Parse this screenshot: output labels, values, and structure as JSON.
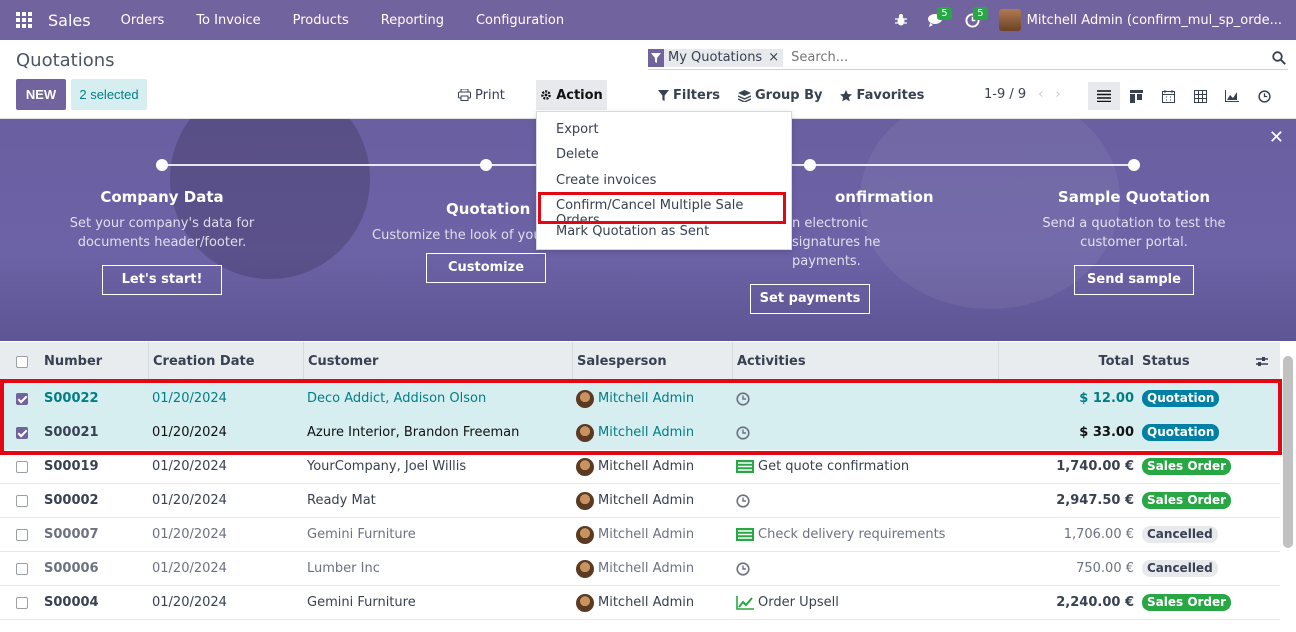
{
  "navbar": {
    "app_name": "Sales",
    "menu": [
      "Orders",
      "To Invoice",
      "Products",
      "Reporting",
      "Configuration"
    ],
    "chat_count": "5",
    "activity_count": "5",
    "user": "Mitchell Admin (confirm_mul_sp_orde..."
  },
  "control_panel": {
    "title": "Quotations",
    "new_label": "NEW",
    "selected_label": "2 selected",
    "print_label": "Print",
    "action_label": "Action",
    "search": {
      "facet": "My Quotations",
      "placeholder": "Search..."
    },
    "filters_label": "Filters",
    "groupby_label": "Group By",
    "favorites_label": "Favorites",
    "pager": "1-9 / 9"
  },
  "action_menu": [
    "Export",
    "Delete",
    "Create invoices",
    "Confirm/Cancel Multiple Sale Orders",
    "Mark Quotation as Sent"
  ],
  "banner": {
    "steps": [
      {
        "title": "Company Data",
        "desc": "Set your company's data for documents header/footer.",
        "button": "Let's start!"
      },
      {
        "title": "Quotation Layo",
        "desc": "Customize the look of your c",
        "button": "Customize"
      },
      {
        "title": "onfirmation",
        "desc": "n electronic signatures he payments.",
        "button": "Set payments"
      },
      {
        "title": "Sample Quotation",
        "desc": "Send a quotation to test the customer portal.",
        "button": "Send sample"
      }
    ]
  },
  "table": {
    "headers": [
      "Number",
      "Creation Date",
      "Customer",
      "Salesperson",
      "Activities",
      "Total",
      "Status"
    ],
    "rows": [
      {
        "number": "S00022",
        "date": "01/20/2024",
        "customer": "Deco Addict, Addison Olson",
        "salesperson": "Mitchell Admin",
        "activity": "",
        "total": "$ 12.00",
        "status": "Quotation"
      },
      {
        "number": "S00021",
        "date": "01/20/2024",
        "customer": "Azure Interior, Brandon Freeman",
        "salesperson": "Mitchell Admin",
        "activity": "",
        "total": "$ 33.00",
        "status": "Quotation"
      },
      {
        "number": "S00019",
        "date": "01/20/2024",
        "customer": "YourCompany, Joel Willis",
        "salesperson": "Mitchell Admin",
        "activity": "Get quote confirmation",
        "total": "1,740.00 €",
        "status": "Sales Order"
      },
      {
        "number": "S00002",
        "date": "01/20/2024",
        "customer": "Ready Mat",
        "salesperson": "Mitchell Admin",
        "activity": "",
        "total": "2,947.50 €",
        "status": "Sales Order"
      },
      {
        "number": "S00007",
        "date": "01/20/2024",
        "customer": "Gemini Furniture",
        "salesperson": "Mitchell Admin",
        "activity": "Check delivery requirements",
        "total": "1,706.00 €",
        "status": "Cancelled"
      },
      {
        "number": "S00006",
        "date": "01/20/2024",
        "customer": "Lumber Inc",
        "salesperson": "Mitchell Admin",
        "activity": "",
        "total": "750.00 €",
        "status": "Cancelled"
      },
      {
        "number": "S00004",
        "date": "01/20/2024",
        "customer": "Gemini Furniture",
        "salesperson": "Mitchell Admin",
        "activity": "Order Upsell",
        "total": "2,240.00 €",
        "status": "Sales Order"
      }
    ]
  }
}
